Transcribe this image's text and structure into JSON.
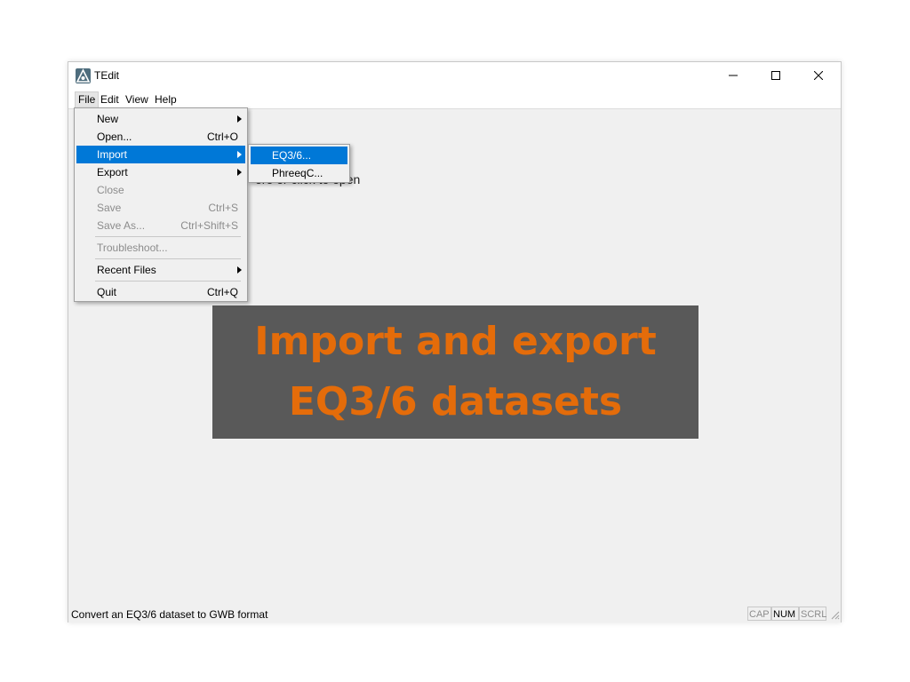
{
  "window": {
    "title": "TEdit",
    "app_icon": "tedit-app-icon",
    "controls": [
      "minimize-icon",
      "maximize-icon",
      "close-icon"
    ]
  },
  "menubar": {
    "items": [
      {
        "label": "File"
      },
      {
        "label": "Edit"
      },
      {
        "label": "View"
      },
      {
        "label": "Help"
      }
    ]
  },
  "file_menu": {
    "new": {
      "label": "New"
    },
    "open": {
      "label": "Open...",
      "shortcut": "Ctrl+O"
    },
    "import": {
      "label": "Import"
    },
    "export": {
      "label": "Export"
    },
    "close": {
      "label": "Close"
    },
    "save": {
      "label": "Save",
      "shortcut": "Ctrl+S"
    },
    "save_as": {
      "label": "Save As...",
      "shortcut": "Ctrl+Shift+S"
    },
    "troubleshoot": {
      "label": "Troubleshoot..."
    },
    "recent_files": {
      "label": "Recent Files"
    },
    "quit": {
      "label": "Quit",
      "shortcut": "Ctrl+Q"
    }
  },
  "import_submenu": {
    "items": [
      {
        "label": "EQ3/6..."
      },
      {
        "label": "PhreeqC..."
      }
    ]
  },
  "main": {
    "hint_text": "ere or click to open"
  },
  "overlay": {
    "line1": "Import and export",
    "line2": "EQ3/6 datasets",
    "text_color": "#e46c0a",
    "background": "#595959"
  },
  "statusbar": {
    "message": "Convert an EQ3/6 dataset to GWB format",
    "indicators": [
      {
        "label": "CAP",
        "active": false
      },
      {
        "label": "NUM",
        "active": true
      },
      {
        "label": "SCRL",
        "active": false
      }
    ]
  },
  "colors": {
    "menu_highlight": "#0078d7",
    "disabled_text": "#8c8c8c"
  }
}
